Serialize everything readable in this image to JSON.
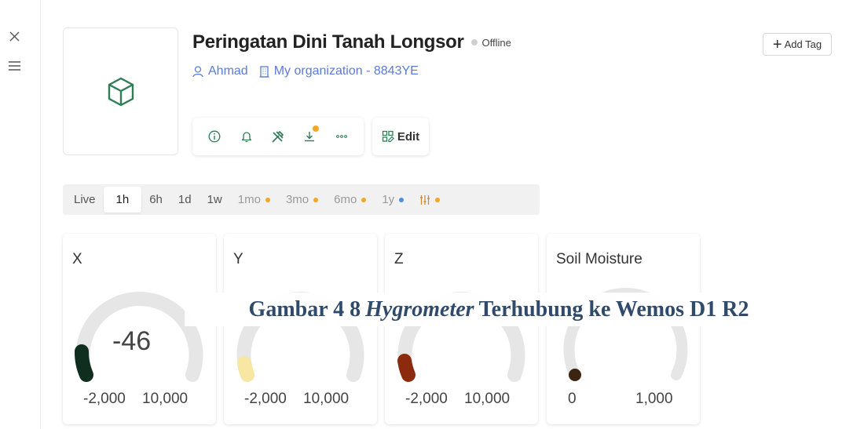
{
  "device": {
    "title": "Peringatan Dini Tanah Longsor",
    "status": "Offline",
    "owner": "Ahmad",
    "organization": "My organization - 8843YE"
  },
  "toolbar": {
    "edit_label": "Edit",
    "icons": [
      "info-icon",
      "bell-icon",
      "tools-icon",
      "download-icon",
      "more-icon"
    ]
  },
  "header": {
    "add_tag_label": "Add Tag"
  },
  "time_ranges": [
    {
      "label": "Live",
      "active": false
    },
    {
      "label": "1h",
      "active": true
    },
    {
      "label": "6h",
      "active": false
    },
    {
      "label": "1d",
      "active": false
    },
    {
      "label": "1w",
      "active": false
    },
    {
      "label": "1mo",
      "dot": "#f5a623"
    },
    {
      "label": "3mo",
      "dot": "#f5a623"
    },
    {
      "label": "6mo",
      "dot": "#f5a623"
    },
    {
      "label": "1y",
      "dot": "#4a90e2"
    }
  ],
  "gauges": [
    {
      "title": "X",
      "value": "-46",
      "min": "-2,000",
      "max": "10,000",
      "color": "#0f2e1f"
    },
    {
      "title": "Y",
      "value": "",
      "min": "-2,000",
      "max": "10,000",
      "color": "#f7e7a3"
    },
    {
      "title": "Z",
      "value": "",
      "min": "-2,000",
      "max": "10,000",
      "color": "#8b2a0c"
    },
    {
      "title": "Soil Moisture",
      "value": "",
      "min": "0",
      "max": "1,000",
      "color": "#3b2410"
    }
  ],
  "caption": {
    "prefix": "Gambar 4 8",
    "italic": "Hygrometer",
    "suffix": "Terhubung ke Wemos D1 R2"
  },
  "colors": {
    "accent_link": "#5c7bd9",
    "device_icon": "#2e7d55",
    "gauge_track": "#e6e6e6"
  }
}
